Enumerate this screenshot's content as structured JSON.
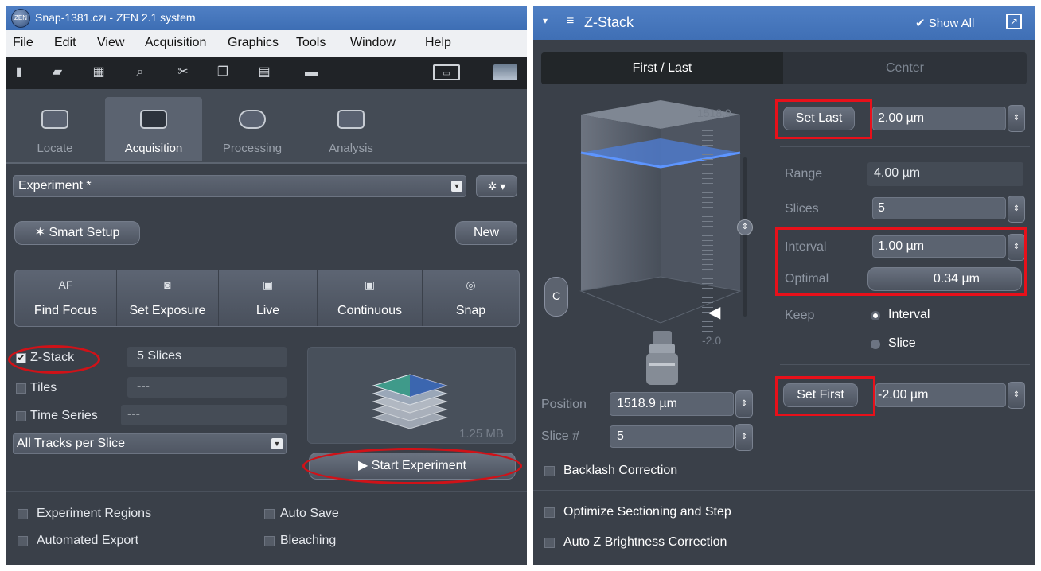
{
  "colors": {
    "accent_blue": "#4a7bc1",
    "panel_bg": "#3a4049",
    "highlight_red": "#e8101a",
    "z_plane_blue": "#4f7fd8"
  },
  "left_window": {
    "title": "Snap-1381.czi - ZEN 2.1 system",
    "app_badge": "ZEN",
    "menu": [
      "File",
      "Edit",
      "View",
      "Acquisition",
      "Graphics",
      "Tools",
      "Window",
      "Help"
    ],
    "toolbar_icons": [
      "pin-icon",
      "open-folder-icon",
      "save-icon",
      "zoom-icon",
      "scissors-icon",
      "copy-icon",
      "paste-icon",
      "scale-bar-icon",
      "display-icon",
      "image-icon"
    ],
    "tabs": [
      {
        "label": "Locate",
        "icon": "locate-icon",
        "active": false
      },
      {
        "label": "Acquisition",
        "icon": "acquisition-icon",
        "active": true
      },
      {
        "label": "Processing",
        "icon": "processing-icon",
        "active": false
      },
      {
        "label": "Analysis",
        "icon": "analysis-icon",
        "active": false
      }
    ],
    "experiment": {
      "value": "Experiment *",
      "gear_icon": "gear-icon"
    },
    "smart_setup_label": "Smart Setup",
    "new_label": "New",
    "acquisition_buttons": [
      {
        "icon_text": "AF",
        "label": "Find Focus"
      },
      {
        "icon_text": "camera-icon",
        "label": "Set Exposure"
      },
      {
        "icon_text": "live-icon",
        "label": "Live"
      },
      {
        "icon_text": "continuous-icon",
        "label": "Continuous"
      },
      {
        "icon_text": "snap-icon",
        "label": "Snap"
      }
    ],
    "dimensions": [
      {
        "label": "Z-Stack",
        "checked": true,
        "value": "5 Slices"
      },
      {
        "label": "Tiles",
        "checked": false,
        "value": "---"
      },
      {
        "label": "Time Series",
        "checked": false,
        "value": "---"
      }
    ],
    "tracks_mode": "All Tracks per Slice",
    "preview_size": "1.25 MB",
    "start_label": "Start Experiment",
    "options": [
      {
        "label": "Experiment Regions",
        "checked": false
      },
      {
        "label": "Auto Save",
        "checked": false
      },
      {
        "label": "Automated Export",
        "checked": false
      },
      {
        "label": "Bleaching",
        "checked": false
      }
    ]
  },
  "z_stack_panel": {
    "title": "Z-Stack",
    "show_all": "Show All",
    "modes": [
      {
        "label": "First / Last",
        "active": true
      },
      {
        "label": "Center",
        "active": false
      }
    ],
    "scale_top": "1518.9",
    "scale_bottom": "-2.0",
    "set_last_label": "Set Last",
    "last_value": "2.00 µm",
    "range_label": "Range",
    "range_value": "4.00 µm",
    "slices_label": "Slices",
    "slices_value": "5",
    "interval_label": "Interval",
    "interval_value": "1.00 µm",
    "optimal_label": "Optimal",
    "optimal_value": "0.34 µm",
    "keep_label": "Keep",
    "keep_options": [
      {
        "label": "Interval",
        "selected": true
      },
      {
        "label": "Slice",
        "selected": false
      }
    ],
    "set_first_label": "Set First",
    "first_value": "-2.00 µm",
    "position_label": "Position",
    "position_value": "1518.9 µm",
    "slice_label": "Slice #",
    "slice_value": "5",
    "focus_icon_letter": "C",
    "checkboxes": [
      {
        "label": "Backlash Correction",
        "checked": false
      },
      {
        "label": "Optimize Sectioning and Step",
        "checked": false
      },
      {
        "label": "Auto Z Brightness Correction",
        "checked": false
      }
    ]
  }
}
